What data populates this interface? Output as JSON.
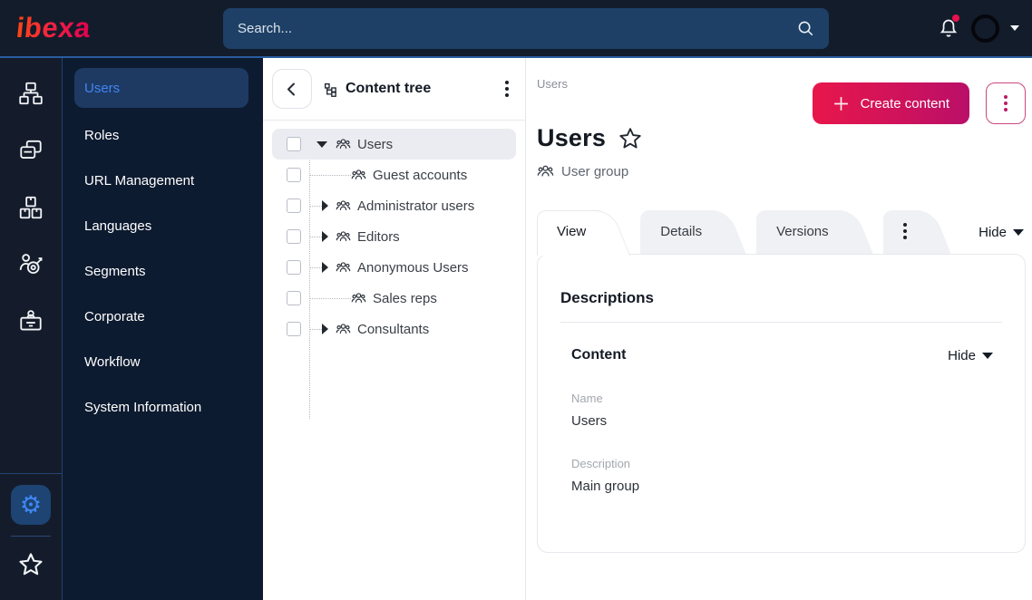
{
  "colors": {
    "brand_gradient_start": "#ff4713",
    "brand_gradient_end": "#e3004f",
    "topbar_bg": "#131c2b",
    "sidebar_bg": "#0d1b30",
    "accent_blue": "#4185f2",
    "selected_menu_bg": "#1e3a63",
    "primary_button_gradient_start": "#e8174b",
    "primary_button_gradient_end": "#ba0f68",
    "notification_dot": "#e8124d",
    "selected_tree_row_bg": "#ebecf1",
    "inactive_tab_bg": "#f0f1f5"
  },
  "topbar": {
    "logo_text": "ibexa",
    "search_placeholder": "Search..."
  },
  "rail": {
    "items": [
      "content-structure",
      "pages",
      "product-catalog",
      "personalization",
      "customer-portal"
    ],
    "bottom_items": [
      "admin-settings",
      "bookmarks"
    ]
  },
  "menu": {
    "items": [
      {
        "label": "Users",
        "active": true
      },
      {
        "label": "Roles",
        "active": false
      },
      {
        "label": "URL Management",
        "active": false
      },
      {
        "label": "Languages",
        "active": false
      },
      {
        "label": "Segments",
        "active": false
      },
      {
        "label": "Corporate",
        "active": false
      },
      {
        "label": "Workflow",
        "active": false
      },
      {
        "label": "System Information",
        "active": false
      }
    ]
  },
  "tree_panel": {
    "title": "Content tree",
    "items": [
      {
        "label": "Users",
        "depth": 0,
        "state": "expanded",
        "selected": true,
        "checked": false
      },
      {
        "label": "Guest accounts",
        "depth": 1,
        "state": "leaf",
        "selected": false,
        "checked": false
      },
      {
        "label": "Administrator users",
        "depth": 1,
        "state": "collapsed",
        "selected": false,
        "checked": false
      },
      {
        "label": "Editors",
        "depth": 1,
        "state": "collapsed",
        "selected": false,
        "checked": false
      },
      {
        "label": "Anonymous Users",
        "depth": 1,
        "state": "collapsed",
        "selected": false,
        "checked": false
      },
      {
        "label": "Sales reps",
        "depth": 1,
        "state": "leaf",
        "selected": false,
        "checked": false
      },
      {
        "label": "Consultants",
        "depth": 1,
        "state": "collapsed",
        "selected": false,
        "checked": false
      }
    ]
  },
  "main": {
    "breadcrumb": "Users",
    "create_button_label": "Create content",
    "page_title": "Users",
    "content_type": "User group",
    "tabs": [
      {
        "label": "View",
        "active": true
      },
      {
        "label": "Details",
        "active": false
      },
      {
        "label": "Versions",
        "active": false
      }
    ],
    "hide_toggle_label": "Hide",
    "card": {
      "heading": "Descriptions",
      "section": {
        "heading": "Content",
        "hide_toggle_label": "Hide",
        "fields": [
          {
            "label": "Name",
            "value": "Users"
          },
          {
            "label": "Description",
            "value": "Main group"
          }
        ]
      }
    }
  }
}
